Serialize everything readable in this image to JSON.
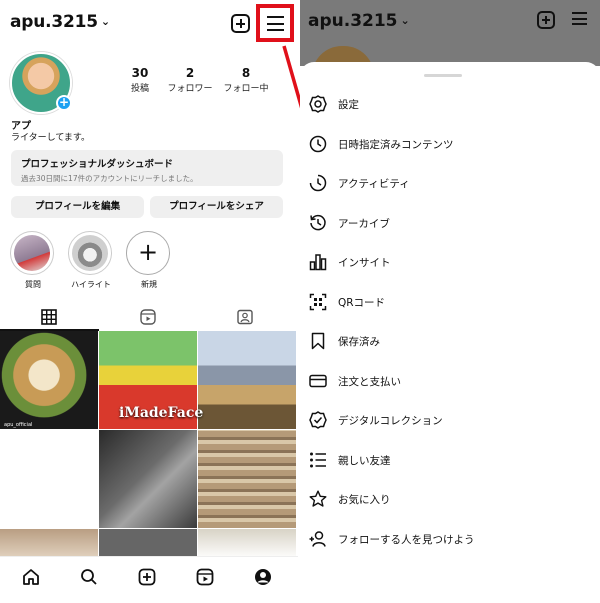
{
  "left": {
    "username": "apu.3215",
    "stats": [
      {
        "num": "30",
        "label": "投稿"
      },
      {
        "num": "2",
        "label": "フォロワー"
      },
      {
        "num": "8",
        "label": "フォロー中"
      }
    ],
    "name": "アプ",
    "bio": "ライターしてます。",
    "dashboard": {
      "title": "プロフェッショナルダッシュボード",
      "subtitle": "過去30日間に17件のアカウントにリーチしました。"
    },
    "edit_profile": "プロフィールを編集",
    "share_profile": "プロフィールをシェア",
    "highlights": [
      {
        "label": "質問"
      },
      {
        "label": "ハイライト"
      },
      {
        "label": "新規"
      }
    ],
    "post_text": "iMadeFace",
    "post_tag": "apu_official",
    "accent": "#e0101a"
  },
  "right": {
    "username": "apu.3215",
    "menu": [
      {
        "label": "設定",
        "icon": "gear-icon"
      },
      {
        "label": "日時指定済みコンテンツ",
        "icon": "clock-icon"
      },
      {
        "label": "アクティビティ",
        "icon": "activity-icon"
      },
      {
        "label": "アーカイブ",
        "icon": "archive-icon"
      },
      {
        "label": "インサイト",
        "icon": "insights-icon"
      },
      {
        "label": "QRコード",
        "icon": "qr-code-icon"
      },
      {
        "label": "保存済み",
        "icon": "bookmark-icon"
      },
      {
        "label": "注文と支払い",
        "icon": "card-icon"
      },
      {
        "label": "デジタルコレクション",
        "icon": "verified-icon"
      },
      {
        "label": "親しい友達",
        "icon": "list-icon"
      },
      {
        "label": "お気に入り",
        "icon": "star-icon"
      },
      {
        "label": "フォローする人を見つけよう",
        "icon": "add-person-icon"
      }
    ]
  }
}
